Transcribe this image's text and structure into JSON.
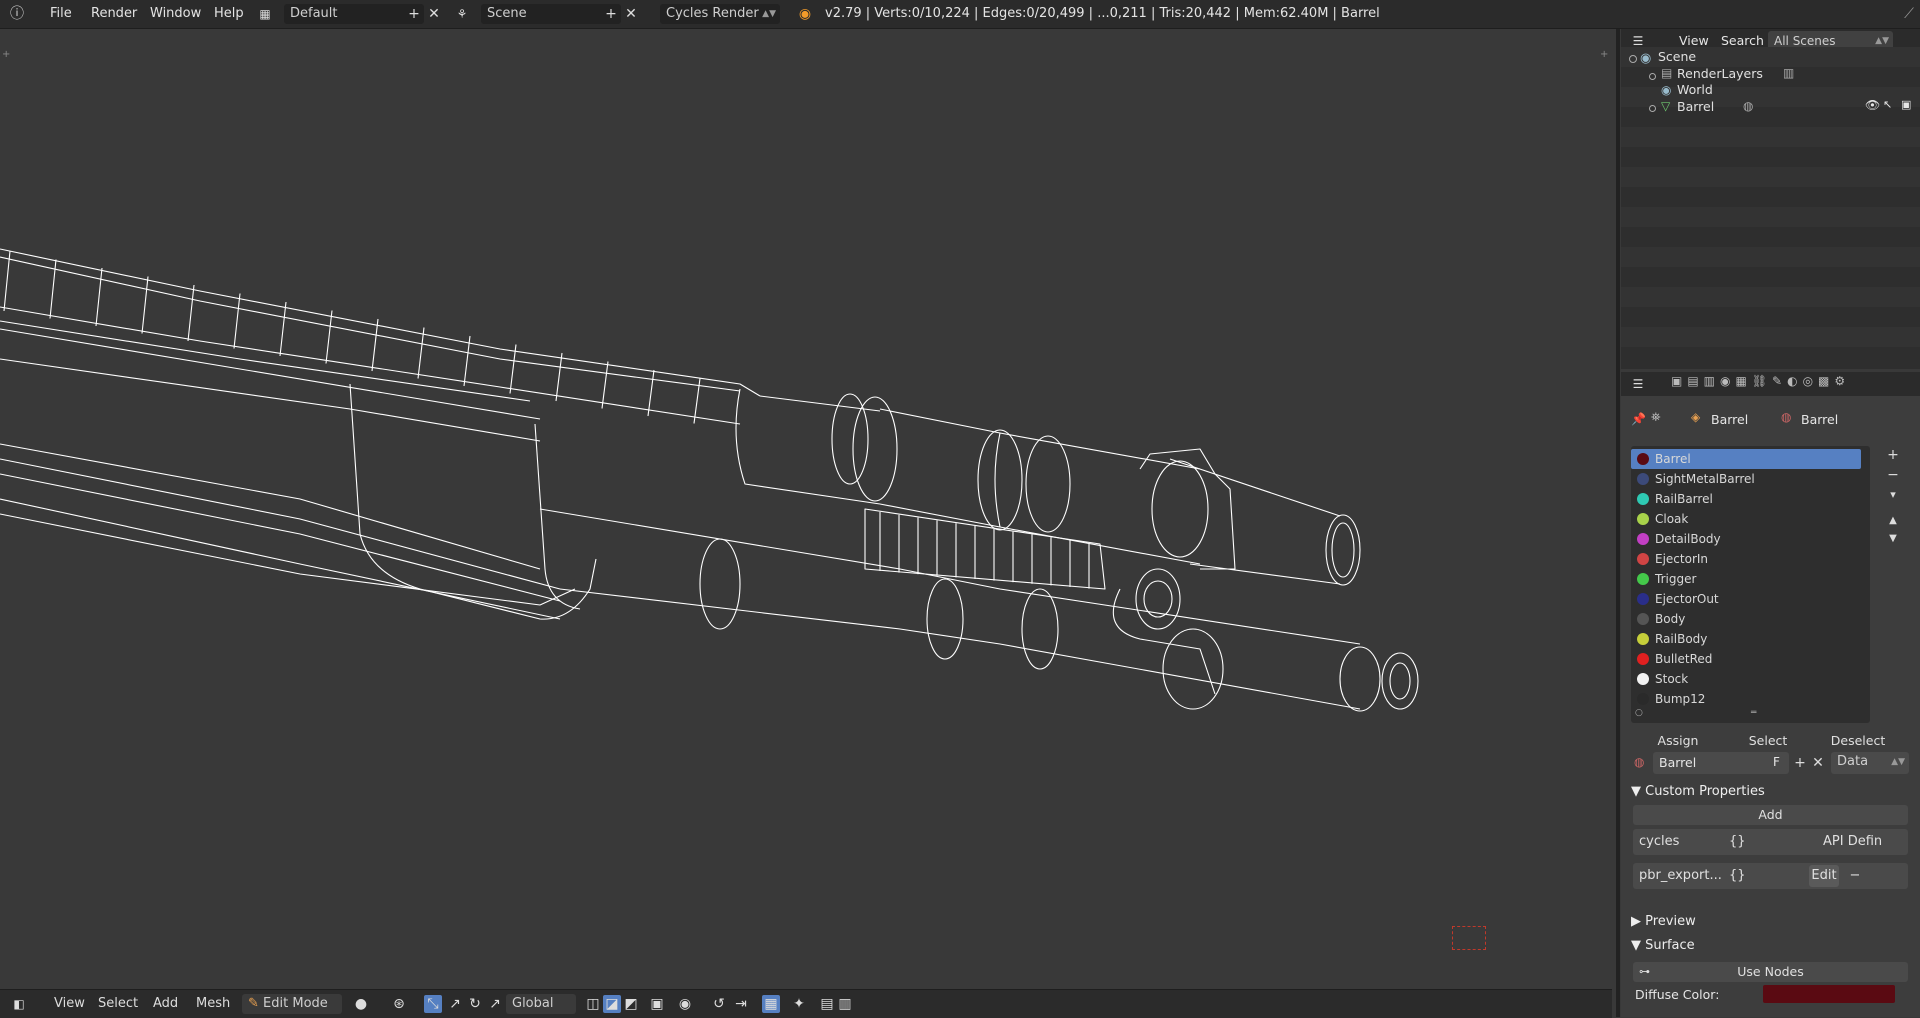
{
  "topbar": {
    "menus": [
      "File",
      "Render",
      "Window",
      "Help"
    ],
    "screen_layout": "Default",
    "scene": "Scene",
    "render_engine": "Cycles Render",
    "stats": "v2.79 | Verts:0/10,224 | Edges:0/20,499 | ...0,211 | Tris:20,442 | Mem:62.40M | Barrel"
  },
  "outliner": {
    "view_label": "View",
    "search_label": "Search",
    "filter": "All Scenes",
    "tree": [
      {
        "label": "Scene",
        "icon": "scene-icon"
      },
      {
        "label": "RenderLayers",
        "icon": "render-layers-icon"
      },
      {
        "label": "World",
        "icon": "world-icon"
      },
      {
        "label": "Barrel",
        "icon": "mesh-object-icon"
      }
    ]
  },
  "properties": {
    "breadcrumb": [
      "Barrel",
      "Barrel"
    ],
    "materials": [
      {
        "name": "Barrel",
        "color": "#5a0a12",
        "selected": true
      },
      {
        "name": "SightMetalBarrel",
        "color": "#3c4a7a"
      },
      {
        "name": "RailBarrel",
        "color": "#2ec9b3"
      },
      {
        "name": "Cloak",
        "color": "#a8d24a"
      },
      {
        "name": "DetailBody",
        "color": "#c23fc4"
      },
      {
        "name": "EjectorIn",
        "color": "#d04444"
      },
      {
        "name": "Trigger",
        "color": "#44c84a"
      },
      {
        "name": "EjectorOut",
        "color": "#2a2e8a"
      },
      {
        "name": "Body",
        "color": "#555555"
      },
      {
        "name": "RailBody",
        "color": "#c6cf3a"
      },
      {
        "name": "BulletRed",
        "color": "#e02020"
      },
      {
        "name": "Stock",
        "color": "#f2f2f2"
      },
      {
        "name": "Bump12",
        "color": "#2a2a2a"
      }
    ],
    "assign_label": "Assign",
    "select_label": "Select",
    "deselect_label": "Deselect",
    "material_field": "Barrel",
    "fake_user": "F",
    "link_mode": "Data",
    "custom_properties_label": "Custom Properties",
    "add_label": "Add",
    "props": [
      {
        "key": "cycles",
        "value": "{}",
        "action": "API Defin"
      },
      {
        "key": "pbr_export...",
        "value": "{}",
        "action": "Edit"
      }
    ],
    "preview_label": "Preview",
    "surface_label": "Surface",
    "use_nodes_label": "Use Nodes",
    "diffuse_label": "Diffuse Color:",
    "diffuse_color": "#5a0a12"
  },
  "bottombar": {
    "menus": [
      "View",
      "Select",
      "Add",
      "Mesh"
    ],
    "mode": "Edit Mode",
    "orientation": "Global"
  }
}
